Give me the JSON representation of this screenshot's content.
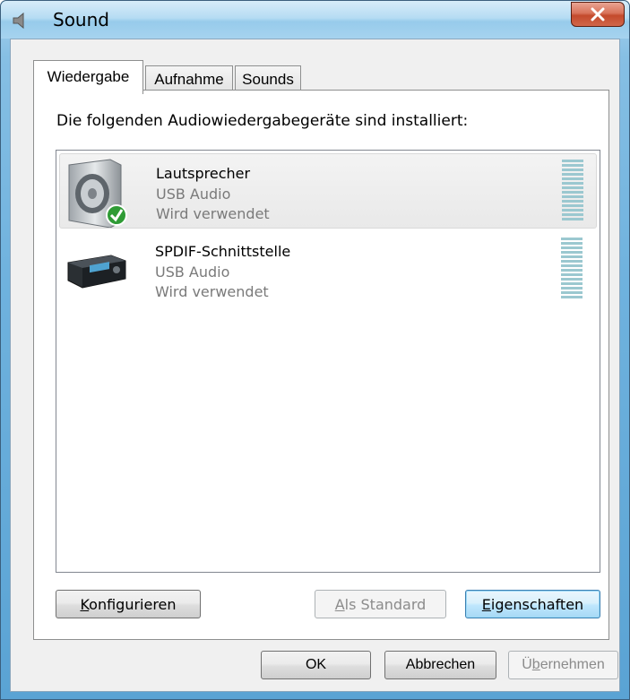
{
  "window": {
    "title": "Sound"
  },
  "tabs": [
    {
      "label": "Wiedergabe",
      "active": true
    },
    {
      "label": "Aufnahme",
      "active": false
    },
    {
      "label": "Sounds",
      "active": false
    }
  ],
  "panel": {
    "label": "Die folgenden Audiowiedergabegeräte sind installiert:"
  },
  "devices": [
    {
      "name": "Lautsprecher",
      "driver": "USB Audio",
      "status": "Wird verwendet",
      "selected": true,
      "default": true,
      "icon": "speaker-icon"
    },
    {
      "name": "SPDIF-Schnittstelle",
      "driver": "USB Audio",
      "status": "Wird verwendet",
      "selected": false,
      "default": false,
      "icon": "receiver-icon"
    }
  ],
  "buttons": {
    "configure": {
      "mnemonic": "K",
      "rest": "onfigurieren"
    },
    "set_default": {
      "mnemonic": "A",
      "rest": "ls Standard",
      "enabled": false
    },
    "properties": {
      "mnemonic": "E",
      "rest": "igenschaften"
    },
    "ok": "OK",
    "cancel": "Abbrechen",
    "apply": {
      "pre": "Ü",
      "mnemonic": "b",
      "rest": "ernehmen",
      "enabled": false
    }
  },
  "colors": {
    "meter": "#9bc8d0",
    "title_close": "#c44a2c",
    "status_text": "#7a7a7a"
  }
}
